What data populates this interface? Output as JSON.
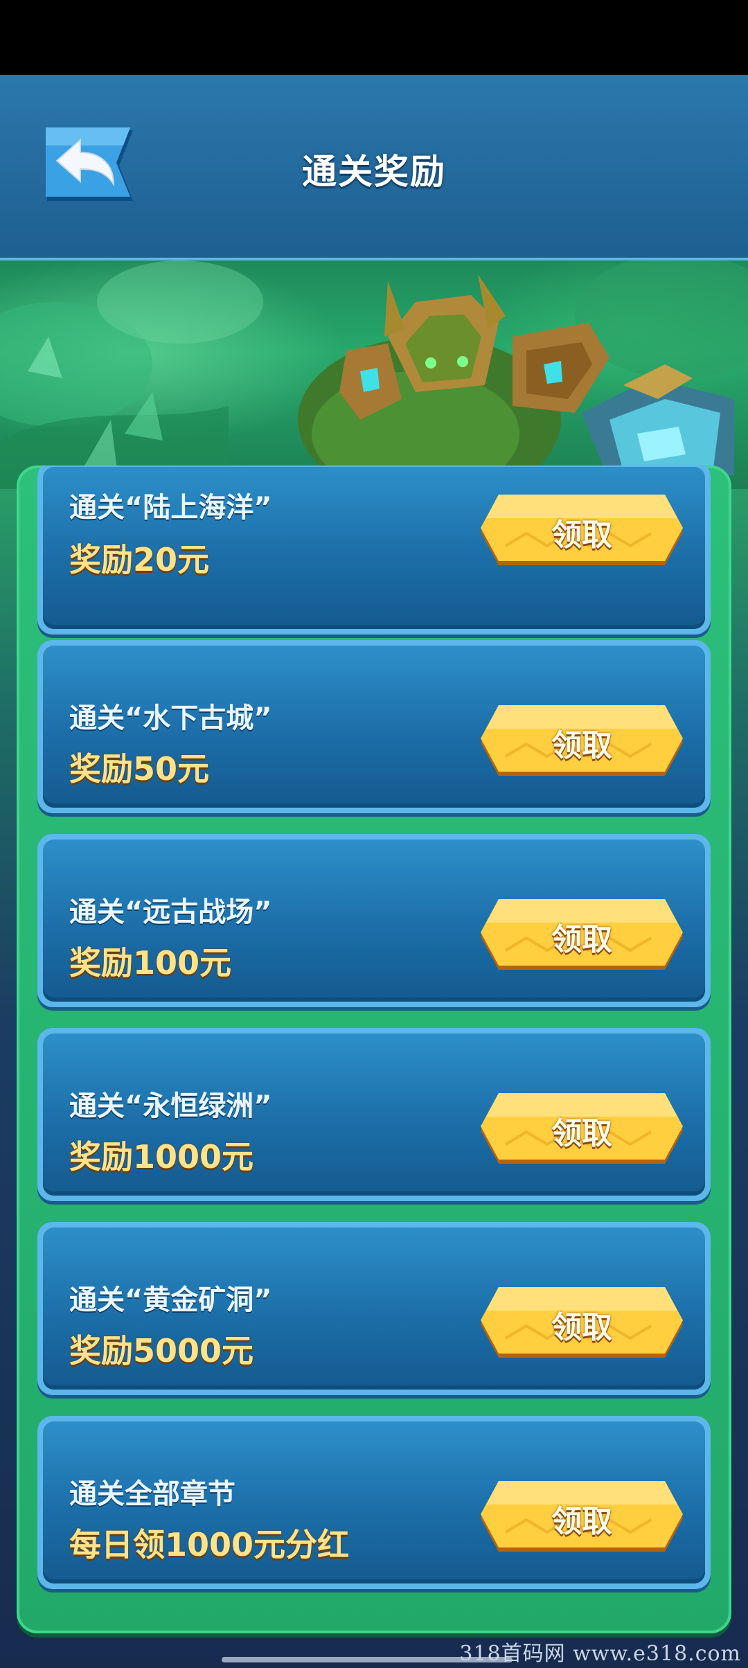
{
  "header": {
    "title": "通关奖励"
  },
  "rewards": [
    {
      "title": "通关“陆上海洋”",
      "reward": "奖励20元",
      "button": "领取"
    },
    {
      "title": "通关“水下古城”",
      "reward": "奖励50元",
      "button": "领取"
    },
    {
      "title": "通关“远古战场”",
      "reward": "奖励100元",
      "button": "领取"
    },
    {
      "title": "通关“永恒绿洲”",
      "reward": "奖励1000元",
      "button": "领取"
    },
    {
      "title": "通关“黄金矿洞”",
      "reward": "奖励5000元",
      "button": "领取"
    },
    {
      "title": "通关全部章节",
      "reward": "每日领1000元分红",
      "button": "领取"
    }
  ],
  "watermark": "318首码网  www.e318.com",
  "colors": {
    "header_bg": "#2b78ad",
    "panel_green": "#2cc07a",
    "card_blue": "#1c6ea8",
    "button_gold": "#ffcf3f",
    "reward_text": "#ffe38a"
  },
  "icons": {
    "back": "back-arrow-icon"
  }
}
